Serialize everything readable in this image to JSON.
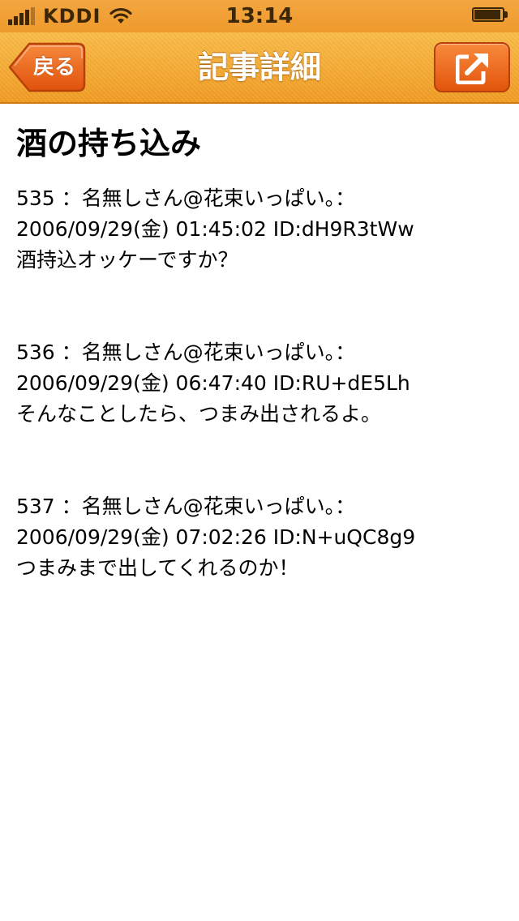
{
  "status_bar": {
    "carrier": "KDDI",
    "time": "13:14",
    "battery_level": 0.95,
    "signal_bars": 4
  },
  "nav_bar": {
    "title": "記事詳細",
    "back_label": "戻る",
    "share_icon": "external-share-icon"
  },
  "article": {
    "title": "酒の持ち込み",
    "posts": [
      {
        "header": "535 ：名無しさん@花束いっぱい。：",
        "meta": "2006/09/29(金) 01:45:02 ID:dH9R3tWw",
        "body": "酒持込オッケーですか？"
      },
      {
        "header": "536 ：名無しさん@花束いっぱい。：",
        "meta": "2006/09/29(金) 06:47:40 ID:RU+dE5Lh",
        "body": "そんなことしたら、つまみ出されるよ。"
      },
      {
        "header": "537 ：名無しさん@花束いっぱい。：",
        "meta": "2006/09/29(金) 07:02:26 ID:N+uQC8g9",
        "body": "つまみまで出してくれるのか！"
      }
    ]
  },
  "colors": {
    "nav_orange": "#f4a22e",
    "share_button": "#e8601a",
    "back_button": "#ec6a1e",
    "title_text": "#ffffff"
  }
}
